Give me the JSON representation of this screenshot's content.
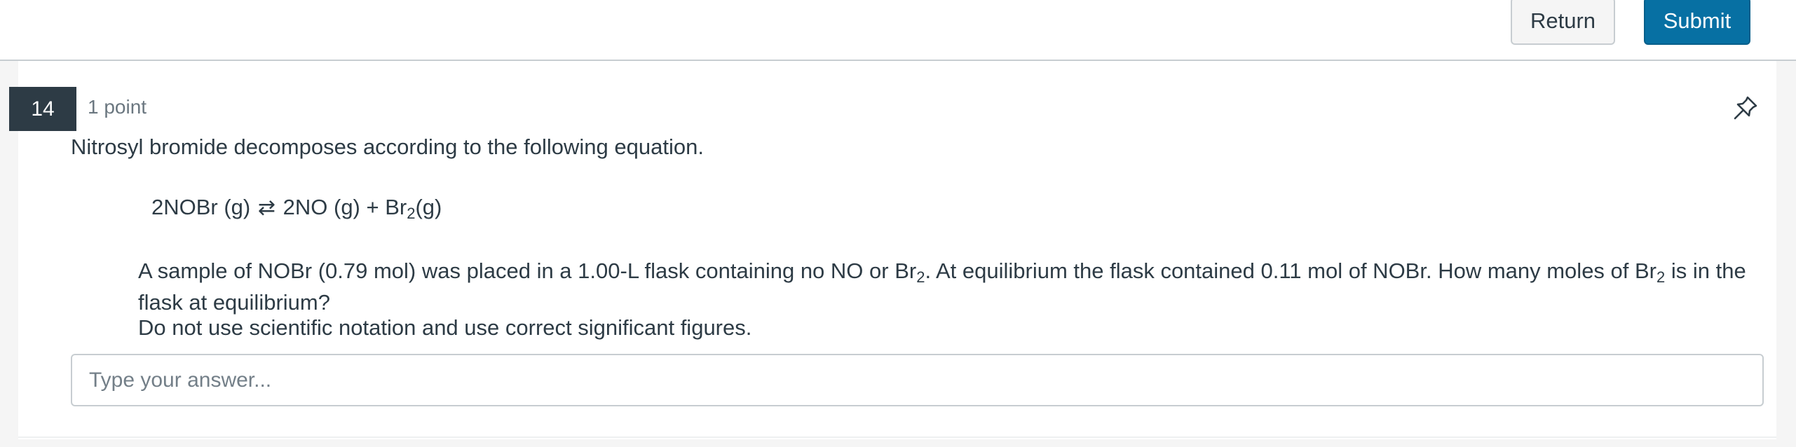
{
  "toolbar": {
    "return_label": "Return",
    "submit_label": "Submit"
  },
  "question": {
    "number": "14",
    "points": "1 point",
    "prompt": "Nitrosyl bromide decomposes according to the following equation.",
    "equation": {
      "reactant": "2NOBr (g)",
      "arrow": "⇄",
      "product1": "2NO (g) +",
      "product2_base": "Br",
      "product2_sub": "2",
      "product2_state": "(g)"
    },
    "body": {
      "part1": "A sample of NOBr (0.79 mol) was placed in a 1.00-L flask containing no NO or Br",
      "sub1": "2",
      "part2": ". At equilibrium the flask contained 0.11 mol of NOBr. How many moles of Br",
      "sub2": "2",
      "part3": " is in the flask at equilibrium?"
    },
    "instruction": "Do not use scientific notation and use correct significant figures.",
    "answer_placeholder": "Type your answer...",
    "pin_icon": "pin-icon"
  },
  "colors": {
    "submit": "#0770a3",
    "text": "#2d3b45",
    "number_badge": "#2d3b45",
    "border": "#c7cdd1"
  }
}
